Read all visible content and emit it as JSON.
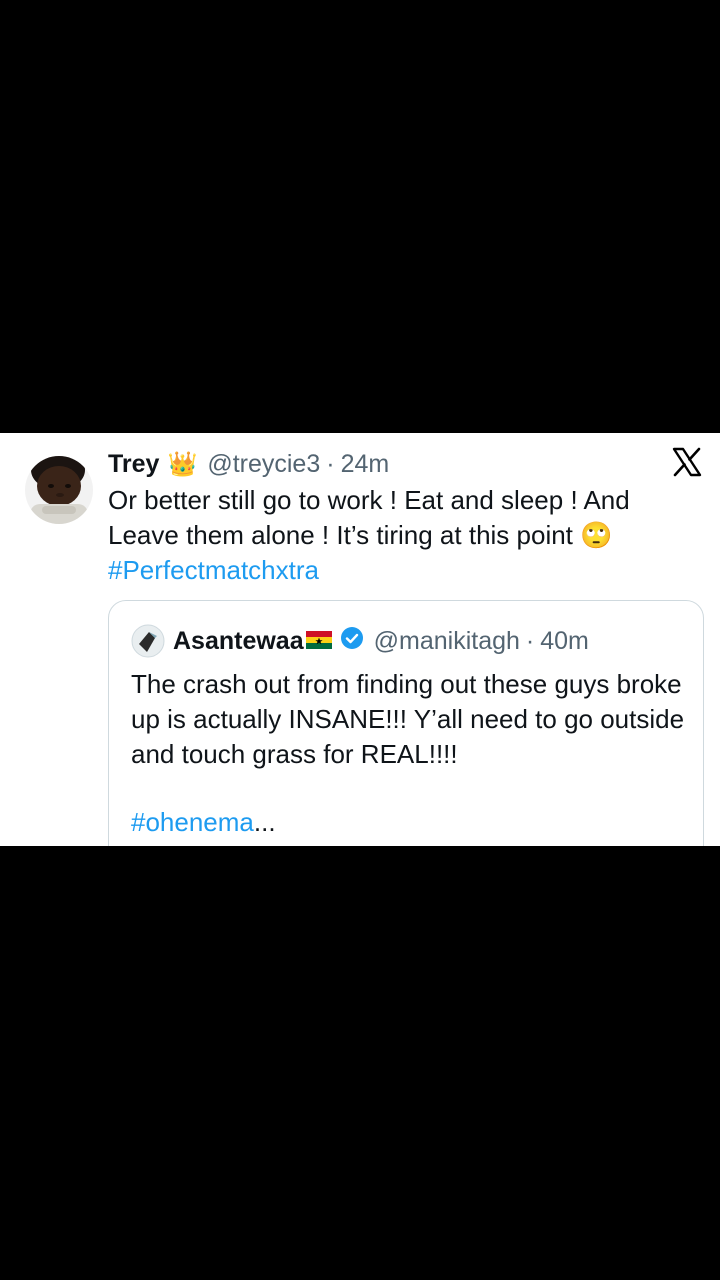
{
  "tweet": {
    "author_name": "Trey",
    "author_emoji": "👑",
    "handle": "@treycie3",
    "separator": "·",
    "time": "24m",
    "text": "Or better still go to work ! Eat and sleep ! And Leave them alone ! It’s tiring at this point 🙄",
    "hashtag": "#Perfectmatchxtra",
    "avatar_icon": "baby-avatar",
    "platform_icon": "x-logo-icon"
  },
  "quoted_tweet": {
    "author_name": "Asantewaa",
    "flag_icon": "ghana-flag-icon",
    "verified_icon": "verified-badge-icon",
    "handle": "@manikitagh",
    "separator": "·",
    "time": "40m",
    "text": "The crash out from finding out these guys broke up is actually INSANE!!! Y’all need to go outside and touch grass for REAL!!!!",
    "hashtag": "#ohenema",
    "truncation": "..."
  },
  "colors": {
    "background": "#000000",
    "card": "#ffffff",
    "text": "#0f1419",
    "secondary": "#536471",
    "link": "#1d9bf0",
    "border": "#cfd9de"
  }
}
